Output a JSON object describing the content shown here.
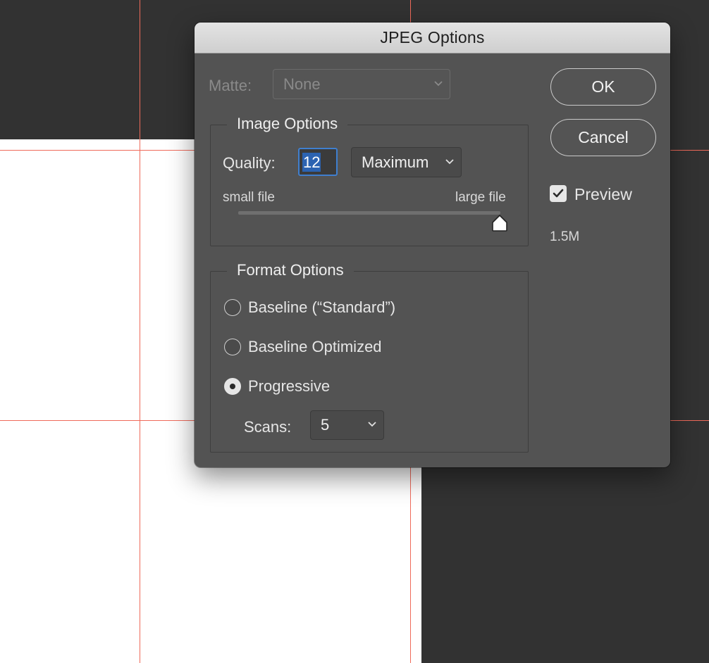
{
  "dialog": {
    "title": "JPEG Options",
    "matte": {
      "label": "Matte:",
      "value": "None"
    },
    "image_options": {
      "title": "Image Options",
      "quality_label": "Quality:",
      "quality_value": "12",
      "quality_preset": "Maximum",
      "small_file_label": "small file",
      "large_file_label": "large file",
      "slider_level": 1.0
    },
    "format_options": {
      "title": "Format Options",
      "choices": [
        "Baseline (“Standard”)",
        "Baseline Optimized",
        "Progressive"
      ],
      "selected": "Progressive",
      "scans_label": "Scans:",
      "scans_value": "5"
    },
    "buttons": {
      "ok": "OK",
      "cancel": "Cancel"
    },
    "preview": {
      "label": "Preview",
      "checked": true
    },
    "file_size": "1.5M"
  },
  "colors": {
    "guide": "#ef6a5a",
    "dialog_bg": "#535353",
    "selection_blue": "#2c63b1"
  }
}
